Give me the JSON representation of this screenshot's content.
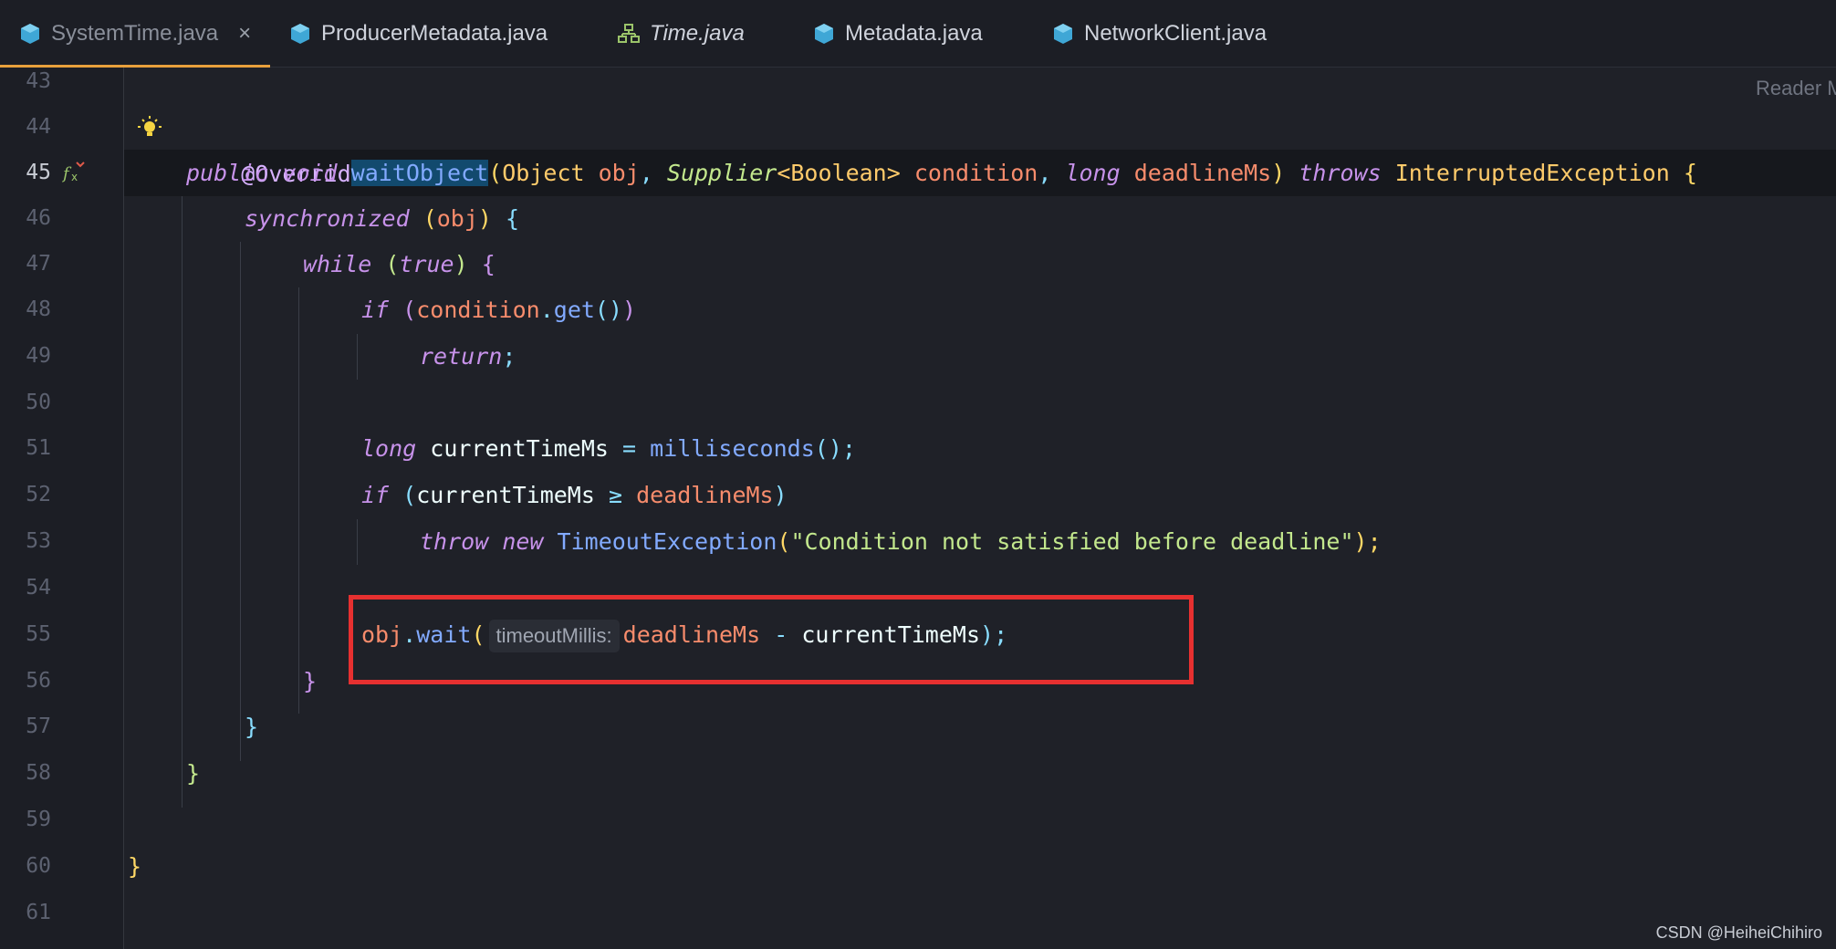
{
  "tabs": [
    {
      "label": "SystemTime.java",
      "active": true,
      "icon": "java-class-icon"
    },
    {
      "label": "ProducerMetadata.java",
      "active": false,
      "icon": "java-class-icon"
    },
    {
      "label": "Time.java",
      "active": false,
      "icon": "java-interface-icon"
    },
    {
      "label": "Metadata.java",
      "active": false,
      "icon": "java-class-icon"
    },
    {
      "label": "NetworkClient.java",
      "active": false,
      "icon": "java-class-icon"
    }
  ],
  "close_glyph": "×",
  "reader_mode": "Reader Mode",
  "line_numbers": [
    "43",
    "44",
    "45",
    "46",
    "47",
    "48",
    "49",
    "50",
    "51",
    "52",
    "53",
    "54",
    "55",
    "56",
    "57",
    "58",
    "59",
    "60",
    "61"
  ],
  "current_line": "45",
  "code": {
    "l44_annotation": "@Override",
    "l45": {
      "public": "public",
      "void": "void",
      "method": "waitObject",
      "open": "(",
      "t1": "Object",
      "p1": "obj",
      "comma1": ",",
      "t2": "Supplier",
      "t2_generic": "<Boolean>",
      "p2": "condition",
      "comma2": ",",
      "t3": "long",
      "p3": "deadlineMs",
      "close": ")",
      "throws": "throws",
      "exc": "InterruptedException",
      "brace": "{"
    },
    "l46": {
      "kw": "synchronized",
      "open": "(",
      "arg": "obj",
      "close": ")",
      "brace": "{"
    },
    "l47": {
      "kw": "while",
      "open": "(",
      "arg": "true",
      "close": ")",
      "brace": "{"
    },
    "l48": {
      "kw": "if",
      "open": "(",
      "obj": "condition",
      "dot": ".",
      "fn": "get",
      "call": "()",
      "close": ")"
    },
    "l49": {
      "kw": "return",
      "semi": ";"
    },
    "l51": {
      "kw": "long",
      "var": "currentTimeMs",
      "eq": "=",
      "fn": "milliseconds",
      "call": "();"
    },
    "l52": {
      "kw": "if",
      "open": "(",
      "var": "currentTimeMs",
      "op": "≥",
      "param": "deadlineMs",
      "close": ")"
    },
    "l53": {
      "kw1": "throw",
      "kw2": "new",
      "cls": "TimeoutException",
      "open": "(",
      "str": "\"Condition not satisfied before deadline\"",
      "close": ");"
    },
    "l55": {
      "obj": "obj",
      "dot": ".",
      "fn": "wait",
      "open": "(",
      "hint": "timeoutMillis:",
      "param": "deadlineMs",
      "op": "-",
      "var": "currentTimeMs",
      "close": ");"
    },
    "l56": "}",
    "l57": "}",
    "l58": "}",
    "l60": "}"
  },
  "watermark": "CSDN @HeiheiChihiro",
  "colors": {
    "background": "#1f2128",
    "highlight_box": "#e63030",
    "tab_underline": "#e8a03c"
  }
}
